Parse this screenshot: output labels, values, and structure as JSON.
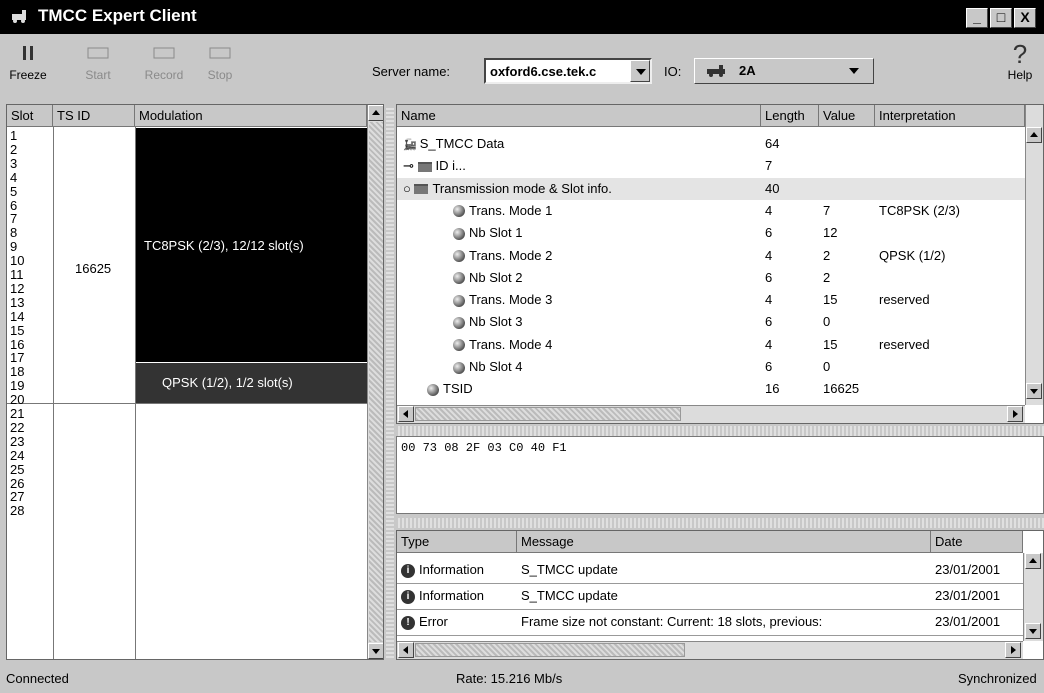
{
  "window": {
    "title": "TMCC Expert Client"
  },
  "toolbar": {
    "freeze_label": "Freeze",
    "start_label": "Start",
    "record_label": "Record",
    "stop_label": "Stop",
    "server_label": "Server name:",
    "server_value": "oxford6.cse.tek.c",
    "io_label": "IO:",
    "io_value": "2A",
    "help_label": "Help"
  },
  "slots_table": {
    "headers": [
      "Slot",
      "TS ID",
      "Modulation"
    ],
    "slot_numbers": [
      "1",
      "2",
      "3",
      "4",
      "5",
      "6",
      "7",
      "8",
      "9",
      "10",
      "11",
      "12",
      "13",
      "14",
      "15",
      "16",
      "17",
      "18",
      "19",
      "20",
      "21",
      "22",
      "23",
      "24",
      "25",
      "26",
      "27",
      "28"
    ],
    "ts_id": "16625",
    "modulation_1": "TC8PSK (2/3), 12/12 slot(s)",
    "modulation_2": "QPSK (1/2), 1/2 slot(s)"
  },
  "tree_table": {
    "headers": [
      "Name",
      "Length",
      "Value",
      "Interpretation"
    ],
    "rows": [
      {
        "name": "S_TMCC Data",
        "length": "64",
        "value": "",
        "interp": "",
        "icon": "train-icon"
      },
      {
        "name": "ID i...",
        "length": "7",
        "value": "",
        "interp": "",
        "icon": "folder-icon"
      },
      {
        "name": "Transmission mode & Slot info.",
        "length": "40",
        "value": "",
        "interp": "",
        "icon": "folder-icon"
      },
      {
        "name": "Trans. Mode 1",
        "length": "4",
        "value": "7",
        "interp": "TC8PSK (2/3)",
        "icon": "ball-icon"
      },
      {
        "name": "Nb Slot 1",
        "length": "6",
        "value": "12",
        "interp": "",
        "icon": "ball-icon"
      },
      {
        "name": "Trans. Mode 2",
        "length": "4",
        "value": "2",
        "interp": "QPSK (1/2)",
        "icon": "ball-icon"
      },
      {
        "name": "Nb Slot 2",
        "length": "6",
        "value": "2",
        "interp": "",
        "icon": "ball-icon"
      },
      {
        "name": "Trans. Mode 3",
        "length": "4",
        "value": "15",
        "interp": "reserved",
        "icon": "ball-icon"
      },
      {
        "name": "Nb Slot 3",
        "length": "6",
        "value": "0",
        "interp": "",
        "icon": "ball-icon"
      },
      {
        "name": "Trans. Mode 4",
        "length": "4",
        "value": "15",
        "interp": "reserved",
        "icon": "ball-icon"
      },
      {
        "name": "Nb Slot 4",
        "length": "6",
        "value": "0",
        "interp": "",
        "icon": "ball-icon"
      },
      {
        "name": "TSID",
        "length": "16",
        "value": "16625",
        "interp": "",
        "icon": "ball-icon"
      }
    ]
  },
  "hex_dump": "00 73 08 2F 03 C0 40 F1",
  "messages": {
    "headers": [
      "Type",
      "Message",
      "Date"
    ],
    "rows": [
      {
        "type": "Information",
        "message": "S_TMCC update",
        "date": "23/01/2001"
      },
      {
        "type": "Information",
        "message": "S_TMCC update",
        "date": "23/01/2001"
      },
      {
        "type": "Error",
        "message": "Frame size not constant: Current: 18 slots, previous:",
        "date": "23/01/2001"
      }
    ]
  },
  "status": {
    "left": "Connected",
    "rate": "Rate: 15.216 Mb/s",
    "right": "Synchronized"
  }
}
